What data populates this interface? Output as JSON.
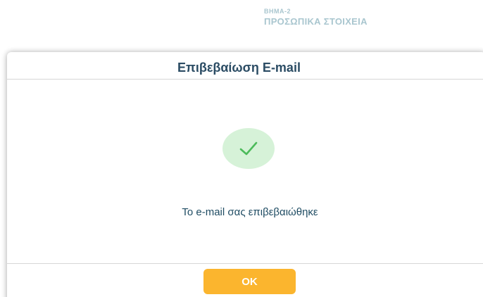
{
  "background": {
    "step_number": "ΒΗΜΑ-2",
    "step_title": "ΠΡΟΣΩΠΙΚΑ ΣΤΟΙΧΕΙΑ"
  },
  "modal": {
    "title": "Επιβεβαίωση E-mail",
    "status_icon": "checkmark-icon",
    "message": "Το e-mail σας επιβεβαιώθηκε",
    "ok_label": "OK"
  },
  "colors": {
    "accent_button": "#fbb52e",
    "success_circle": "#d6f2d8",
    "success_check": "#4cbb5a",
    "title_text": "#2b4c64",
    "step_text": "#a9c6cf"
  }
}
